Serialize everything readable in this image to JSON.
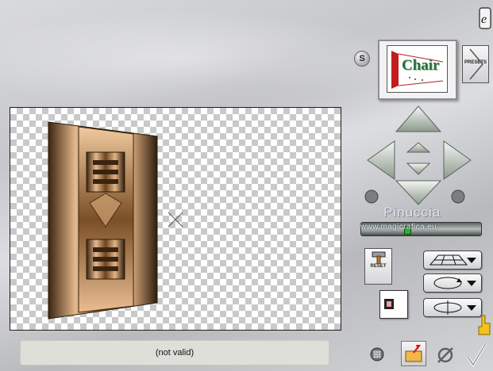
{
  "status": {
    "text": "(not valid)"
  },
  "preview": {
    "label": "Chair"
  },
  "buttons": {
    "s_label": "S",
    "presets_label": "PRESETS",
    "reset_label": "RESET"
  },
  "watermark": {
    "name": "Pinuccia",
    "url": "www.magicrafica.eu"
  },
  "slider": {
    "value_fraction": 0.38
  },
  "icons": {
    "logo": "e-logo-icon",
    "arrows": [
      "arrow-up-icon",
      "arrow-left-icon",
      "arrow-right-icon",
      "arrow-down-icon",
      "small-arrow-up-icon",
      "small-arrow-down-icon"
    ],
    "rotate": [
      "rotate-left-icon",
      "rotate-right-icon"
    ],
    "dropdowns": [
      "perspective-grid-icon",
      "rotate-ellipse-icon",
      "rotate-flip-icon"
    ],
    "bottom": [
      "grid-icon",
      "folder-import-icon",
      "null-icon",
      "check-icon",
      "hand-pointer-icon"
    ]
  },
  "colors": {
    "copper_dark": "#3a2410",
    "copper_light": "#e6b98e",
    "button_green": "#cfd9d0"
  }
}
